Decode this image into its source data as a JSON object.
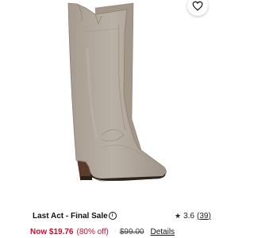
{
  "product": {
    "brand_label": "Last Act - Final Sale",
    "info_icon": "info-icon",
    "wishlist_icon": "heart-icon",
    "image_icon": "boot-product-image"
  },
  "rating": {
    "star_icon": "star-icon",
    "value": "3.6",
    "count": "(39)"
  },
  "price": {
    "now": "Now $19.76",
    "discount": "(80% off)",
    "original": "$99.00",
    "details_label": "Details"
  },
  "colors": {
    "sale_red": "#c8102e",
    "boot_suede": "#b3a99d",
    "text": "#111111"
  }
}
